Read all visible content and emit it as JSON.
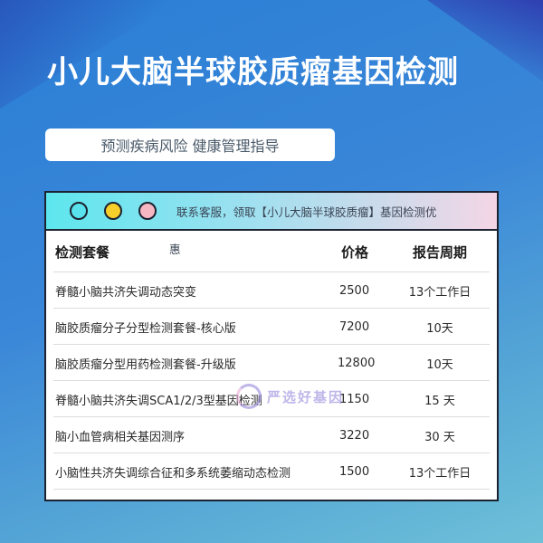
{
  "title": "小儿大脑半球胶质瘤基因检测",
  "subtitle": "预测疾病风险 健康管理指导",
  "card": {
    "note_part1": "联系客服，领取【小儿大脑半球胶质瘤】基因检测优",
    "note_part2": "惠"
  },
  "table": {
    "headers": {
      "name": "检测套餐",
      "price": "价格",
      "period": "报告周期"
    },
    "rows": [
      {
        "name": "脊髓小脑共济失调动态突变",
        "price": "2500",
        "period": "13个工作日"
      },
      {
        "name": "脑胶质瘤分子分型检测套餐-核心版",
        "price": "7200",
        "period": "10天"
      },
      {
        "name": "脑胶质瘤分型用药检测套餐-升级版",
        "price": "12800",
        "period": "10天"
      },
      {
        "name": "脊髓小脑共济失调SCA1/2/3型基因检测",
        "price": "1150",
        "period": "15 天"
      },
      {
        "name": "脑小血管病相关基因测序",
        "price": "3220",
        "period": "30 天"
      },
      {
        "name": "小脑性共济失调综合征和多系统萎缩动态检测",
        "price": "1500",
        "period": "13个工作日"
      }
    ]
  },
  "watermark": "严选好基因"
}
